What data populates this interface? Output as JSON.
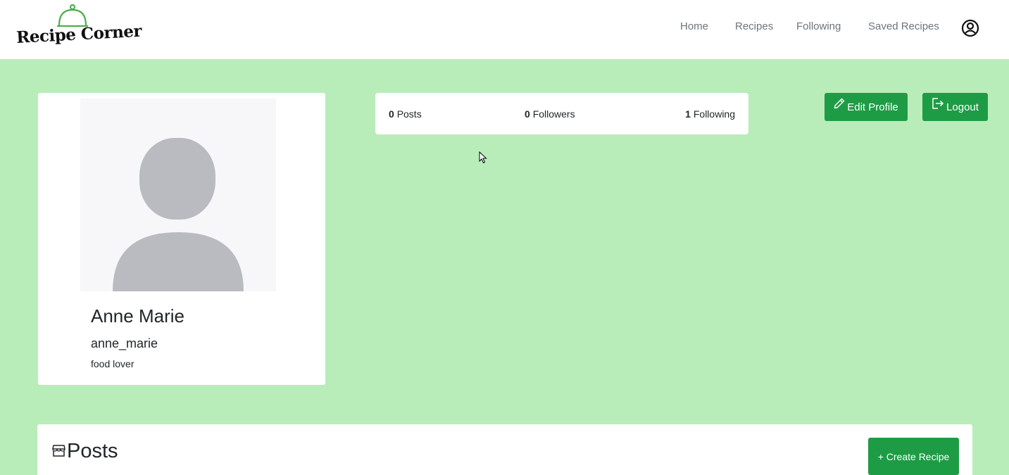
{
  "brand": {
    "name": "Recipe Corner",
    "icon": "cloche-icon",
    "accent_color": "#4caf50"
  },
  "nav": {
    "home": "Home",
    "recipes": "Recipes",
    "following": "Following",
    "saved": "Saved Recipes",
    "account_icon": "user-circle-icon"
  },
  "profile": {
    "name": "Anne Marie",
    "username": "anne_marie",
    "bio": "food lover",
    "avatar_icon": "default-avatar-icon"
  },
  "stats": {
    "posts_count": "0",
    "posts_label": "Posts",
    "followers_count": "0",
    "followers_label": "Followers",
    "following_count": "1",
    "following_label": "Following"
  },
  "actions": {
    "edit_profile": "Edit Profile",
    "edit_icon": "pencil-icon",
    "logout": "Logout",
    "logout_icon": "logout-icon"
  },
  "posts": {
    "title": "Posts",
    "icon": "storefront-icon",
    "create_label": "+ Create Recipe"
  },
  "colors": {
    "background": "#b8edb9",
    "button": "#1e9c45",
    "nav_text": "#6c757d",
    "avatar_silhouette": "#b9bbc1"
  }
}
